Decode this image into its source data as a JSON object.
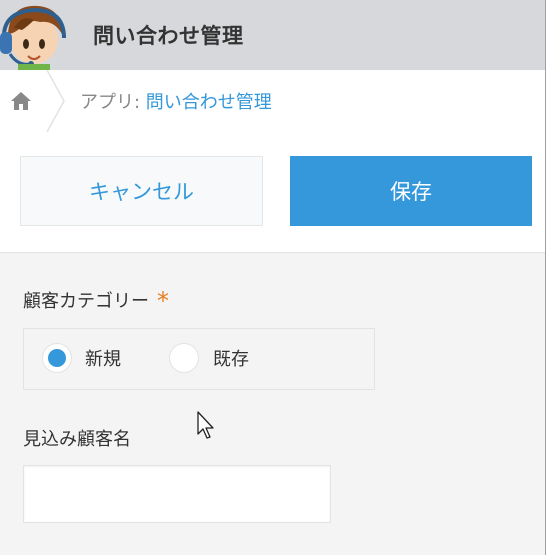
{
  "header": {
    "app_title": "問い合わせ管理"
  },
  "breadcrumb": {
    "prefix": "アプリ: ",
    "app_link": "問い合わせ管理"
  },
  "toolbar": {
    "cancel_label": "キャンセル",
    "save_label": "保存"
  },
  "form": {
    "category_label": "顧客カテゴリー",
    "required_mark": "*",
    "options": [
      {
        "label": "新規",
        "selected": true
      },
      {
        "label": "既存",
        "selected": false
      }
    ],
    "prospect_name_label": "見込み顧客名",
    "prospect_name_value": ""
  },
  "colors": {
    "accent": "#3498db",
    "required": "#e67e22",
    "header_bg": "#d6d8db"
  },
  "icons": {
    "home": "home-icon",
    "avatar": "support-agent-avatar",
    "cursor": "mouse-pointer"
  }
}
